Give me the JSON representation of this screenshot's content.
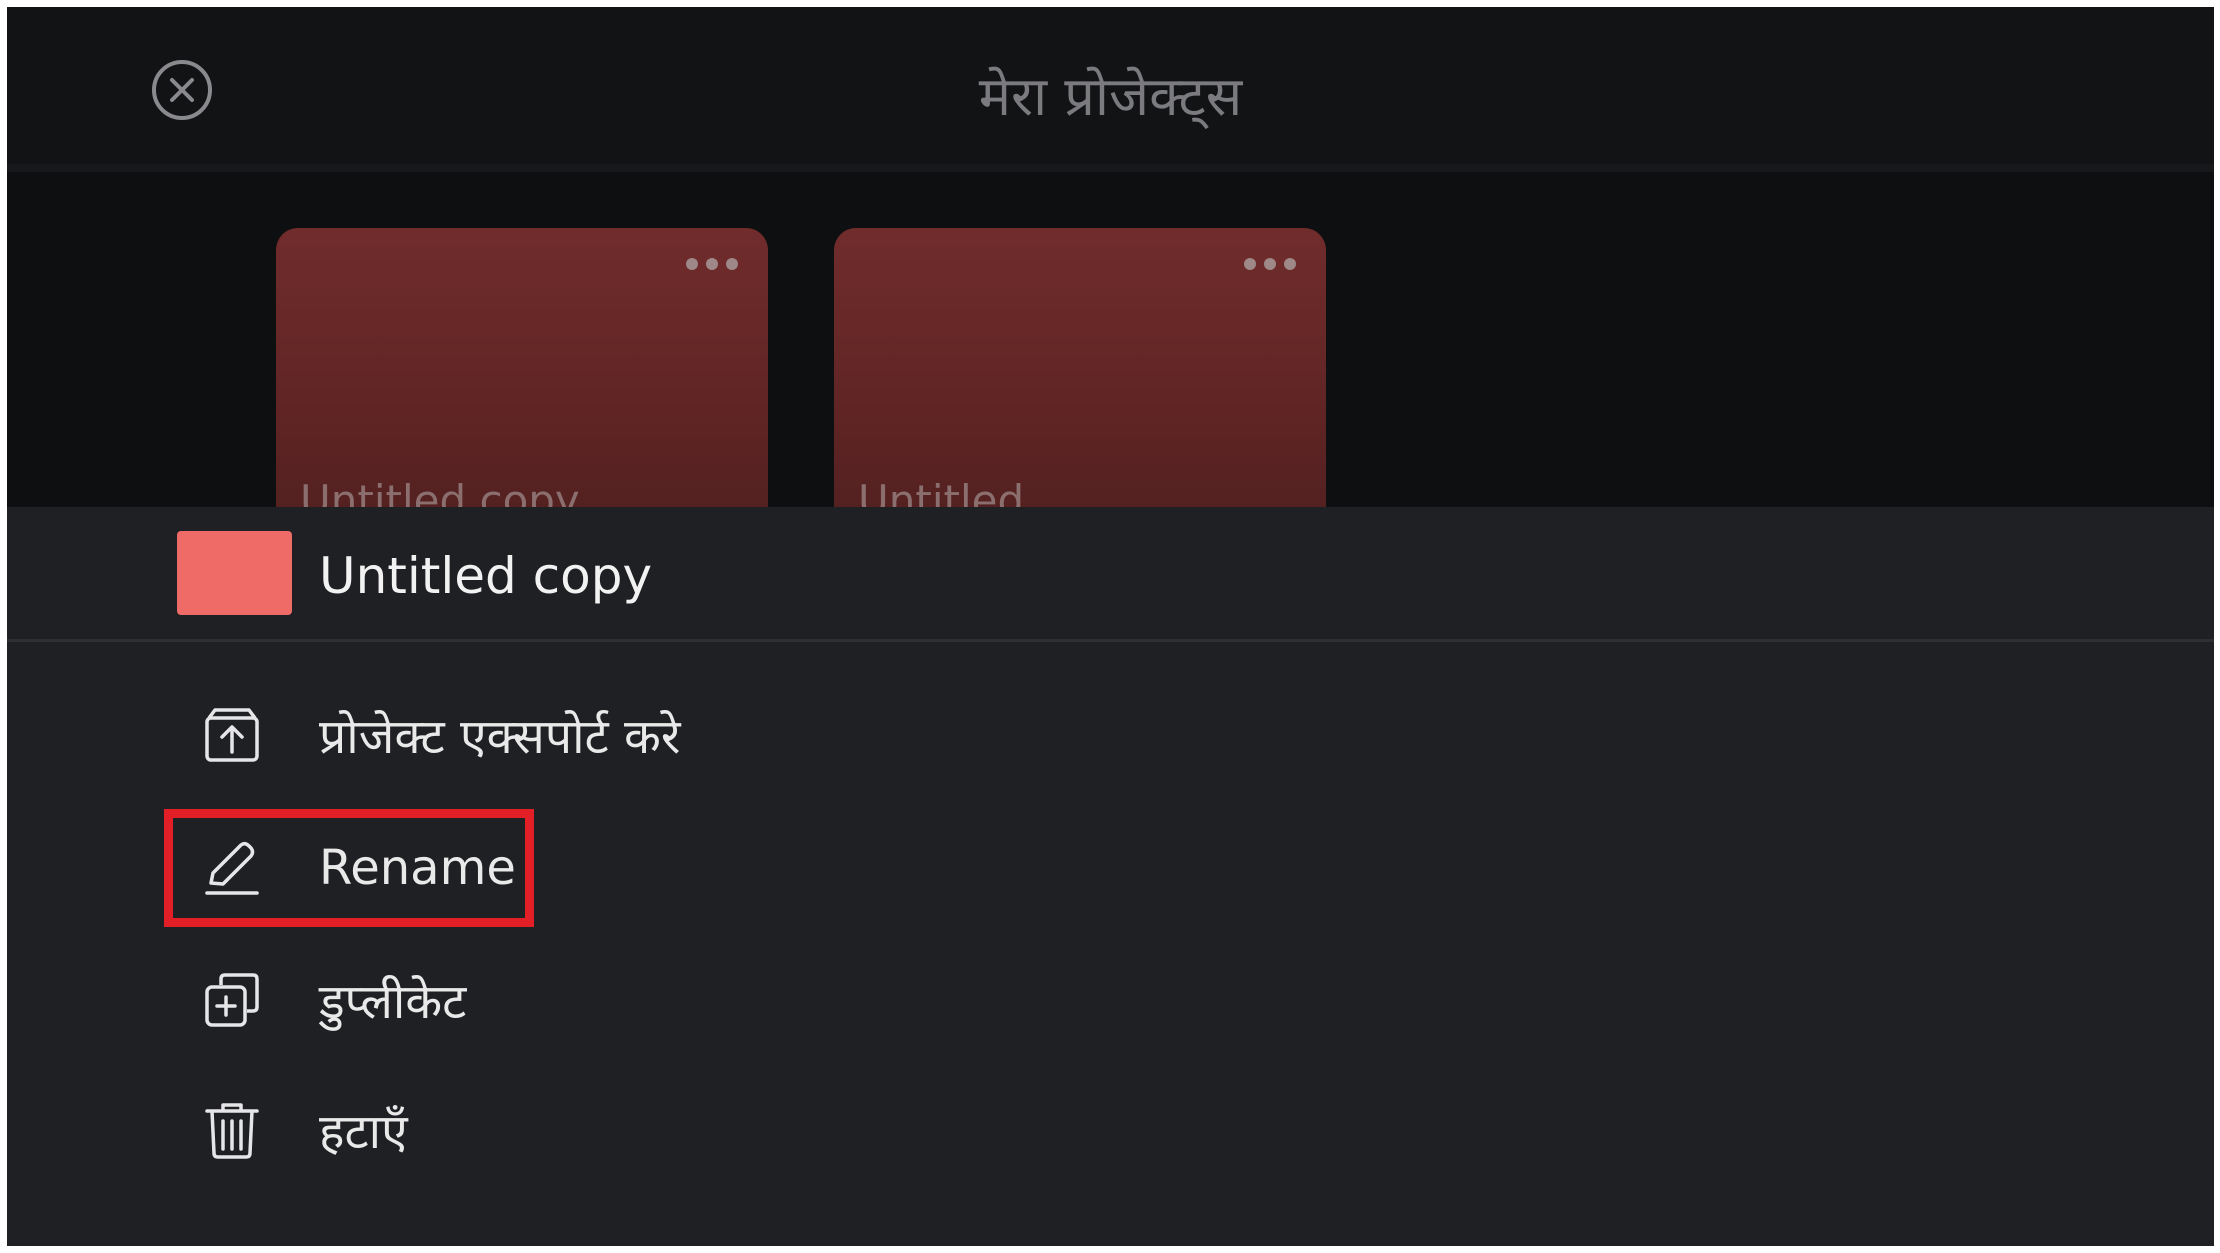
{
  "header": {
    "title": "मेरा प्रोजेक्ट्स",
    "close_icon": "close-circle-icon"
  },
  "projects": [
    {
      "name": "Untitled copy",
      "menu_icon": "more-horizontal-icon"
    },
    {
      "name": "Untitled",
      "menu_icon": "more-horizontal-icon"
    }
  ],
  "sheet": {
    "project_name": "Untitled copy",
    "swatch_color": "#ee6b68",
    "items": [
      {
        "label": "प्रोजेक्ट एक्सपोर्ट करे",
        "icon": "export-icon"
      },
      {
        "label": "Rename",
        "icon": "pencil-icon"
      },
      {
        "label": "डुप्लीकेट",
        "icon": "duplicate-icon"
      },
      {
        "label": "हटाएँ",
        "icon": "trash-icon"
      }
    ]
  },
  "colors": {
    "highlight": "#e21e26",
    "card": "#712c2c",
    "background": "#0e0f11",
    "sheet": "#1f2023"
  }
}
